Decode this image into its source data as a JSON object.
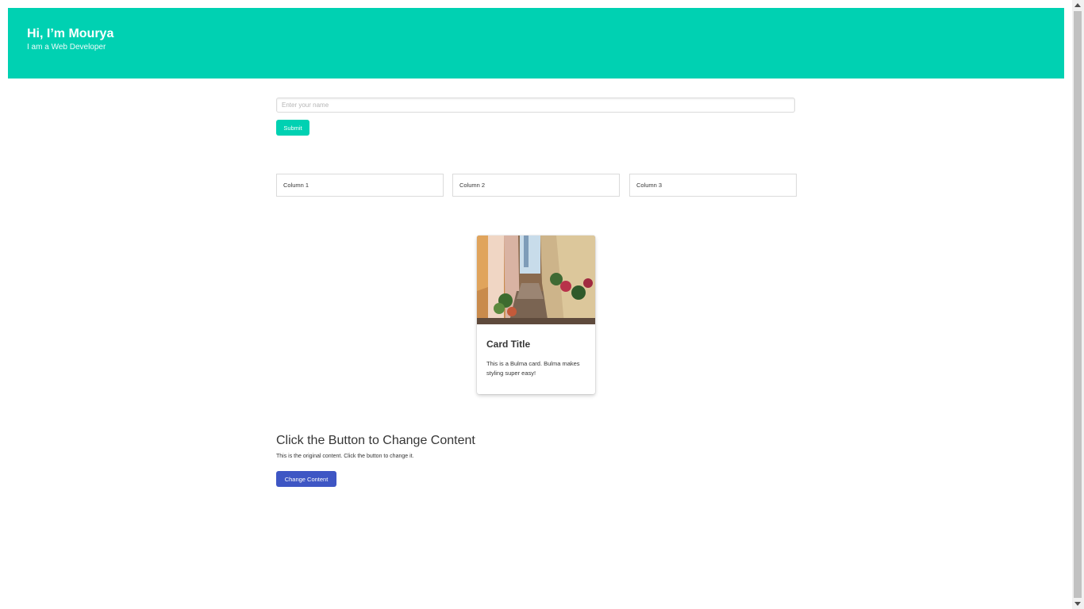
{
  "hero": {
    "title": "Hi, I’m Mourya",
    "subtitle": "I am a Web Developer"
  },
  "form": {
    "name_placeholder": "Enter your name",
    "submit_label": "Submit"
  },
  "columns": [
    {
      "label": "Column 1"
    },
    {
      "label": "Column 2"
    },
    {
      "label": "Column 3"
    }
  ],
  "card": {
    "title": "Card Title",
    "text": "This is a Bulma card. Bulma makes styling super easy!",
    "image": "street-alley-photo"
  },
  "content_section": {
    "heading": "Click the Button to Change Content",
    "paragraph": "This is the original content. Click the button to change it.",
    "button_label": "Change Content"
  },
  "colors": {
    "hero": "#00d1b2",
    "submit": "#00d1b2",
    "change_button": "#3e56c4"
  },
  "icons": {
    "scroll_up": "arrow-up-icon",
    "scroll_down": "arrow-down-icon"
  }
}
